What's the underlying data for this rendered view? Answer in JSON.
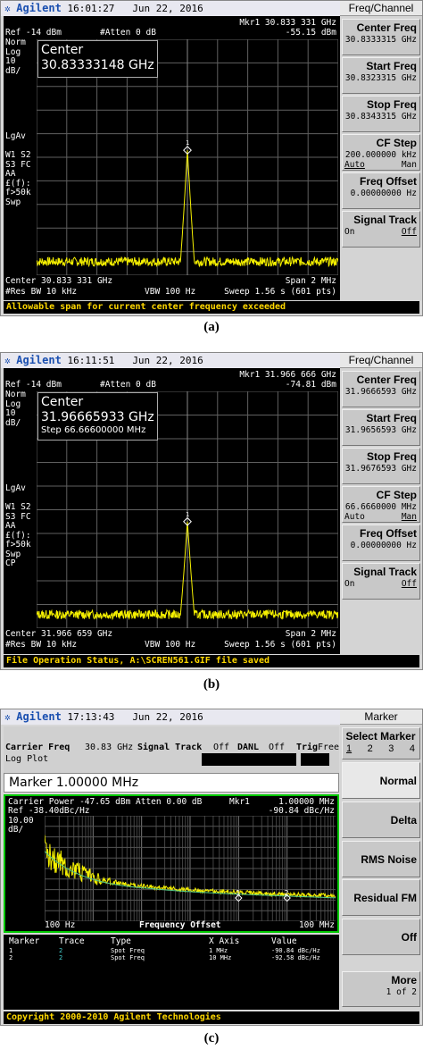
{
  "a": {
    "brand": "Agilent",
    "time": "16:01:27",
    "date": "Jun 22, 2016",
    "mkr_label": "Mkr1  30.833 331 GHz",
    "ref": "Ref -14 dBm",
    "atten": "#Atten 0 dB",
    "mkr_val": "-55.15 dBm",
    "left": [
      "Norm",
      "Log",
      "10",
      "dB/",
      "",
      "",
      "",
      "",
      "",
      "",
      "LgAv",
      "",
      "W1  S2",
      "S3  FC",
      "AA",
      "£(f):",
      "f>50k",
      "Swp"
    ],
    "center_lbl": "Center",
    "center_val": "30.83333148 GHz",
    "bottom_center": "Center 30.833 331 GHz",
    "span": "Span 2 MHz",
    "resbw": "#Res BW 10 kHz",
    "vbw": "VBW 100 Hz",
    "sweep": "Sweep 1.56 s (601 pts)",
    "status": "Allowable span for current center frequency exceeded",
    "menu": "Freq/Channel",
    "keys": [
      {
        "l1": "Center Freq",
        "l2": "30.8333315 GHz"
      },
      {
        "l1": "Start Freq",
        "l2": "30.8323315 GHz"
      },
      {
        "l1": "Stop Freq",
        "l2": "30.8343315 GHz"
      },
      {
        "l1": "CF Step",
        "l2": "200.000000 kHz",
        "o1": "Auto",
        "o2": "Man"
      },
      {
        "l1": "Freq Offset",
        "l2": "0.00000000  Hz"
      },
      {
        "l1": "Signal Track",
        "o1": "On",
        "o2": "Off"
      }
    ],
    "caption": "(a)"
  },
  "b": {
    "brand": "Agilent",
    "time": "16:11:51",
    "date": "Jun 22, 2016",
    "mkr_label": "Mkr1  31.966 666 GHz",
    "ref": "Ref -14 dBm",
    "atten": "#Atten 0 dB",
    "mkr_val": "-74.81 dBm",
    "left": [
      "Norm",
      "Log",
      "10",
      "dB/",
      "",
      "",
      "",
      "",
      "",
      "",
      "LgAv",
      "",
      "W1  S2",
      "S3  FC",
      "AA",
      "£(f):",
      "f>50k",
      "Swp",
      "CP"
    ],
    "center_lbl": "Center",
    "center_val": "31.96665933 GHz",
    "step": "Step 66.66600000 MHz",
    "bottom_center": "Center 31.966 659 GHz",
    "span": "Span 2 MHz",
    "resbw": "#Res BW 10 kHz",
    "vbw": "VBW 100 Hz",
    "sweep": "Sweep 1.56 s (601 pts)",
    "status": "File Operation Status, A:\\SCREN561.GIF file saved",
    "menu": "Freq/Channel",
    "keys": [
      {
        "l1": "Center Freq",
        "l2": "31.9666593 GHz"
      },
      {
        "l1": "Start Freq",
        "l2": "31.9656593 GHz"
      },
      {
        "l1": "Stop Freq",
        "l2": "31.9676593 GHz"
      },
      {
        "l1": "CF Step",
        "l2": "66.6660000 MHz",
        "o1": "Auto",
        "o2": "Man"
      },
      {
        "l1": "Freq Offset",
        "l2": "0.00000000  Hz"
      },
      {
        "l1": "Signal Track",
        "o1": "On",
        "o2": "Off"
      }
    ],
    "caption": "(b)"
  },
  "c": {
    "brand": "Agilent",
    "time": "17:13:43",
    "date": "Jun 22, 2016",
    "carrier_freq_lbl": "Carrier Freq",
    "carrier_freq": "30.83 GHz",
    "signal_track_lbl": "Signal Track",
    "signal_track": "Off",
    "danl_lbl": "DANL",
    "danl": "Off",
    "trig_lbl": "Trig",
    "trig": "Free",
    "logplot": "Log Plot",
    "marker_box": "Marker 1.00000 MHz",
    "carrier_power": "Carrier Power -47.65 dBm",
    "atten": "Atten  0.00 dB",
    "mkr": "Mkr1",
    "mkr_x": "1.00000 MHz",
    "ref": "Ref -38.40dBc/Hz",
    "mkr_y": "-90.84 dBc/Hz",
    "scale1": "10.00",
    "scale2": "dB/",
    "x_start": "100 Hz",
    "x_label": "Frequency Offset",
    "x_end": "100 MHz",
    "table_headers": [
      "Marker",
      "Trace",
      "Type",
      "X Axis",
      "Value"
    ],
    "table_rows": [
      [
        "1",
        "2",
        "Spot Freq",
        "1 MHz",
        "-90.84 dBc/Hz"
      ],
      [
        "2",
        "2",
        "Spot Freq",
        "10 MHz",
        "-92.58 dBc/Hz"
      ]
    ],
    "menu": "Marker",
    "select_marker": "Select Marker",
    "select_opts": [
      "1",
      "2",
      "3",
      "4"
    ],
    "keys": [
      "Normal",
      "Delta",
      "RMS Noise",
      "Residual FM",
      "Off"
    ],
    "more": "More",
    "more_sub": "1 of 2",
    "status": "Copyright 2000-2010 Agilent Technologies",
    "caption": "(c)"
  },
  "colors": {
    "trace": "#f5f000",
    "trace2": "#55cc88",
    "grid": "#606060",
    "status": "#ffd800",
    "green": "#00c800"
  }
}
